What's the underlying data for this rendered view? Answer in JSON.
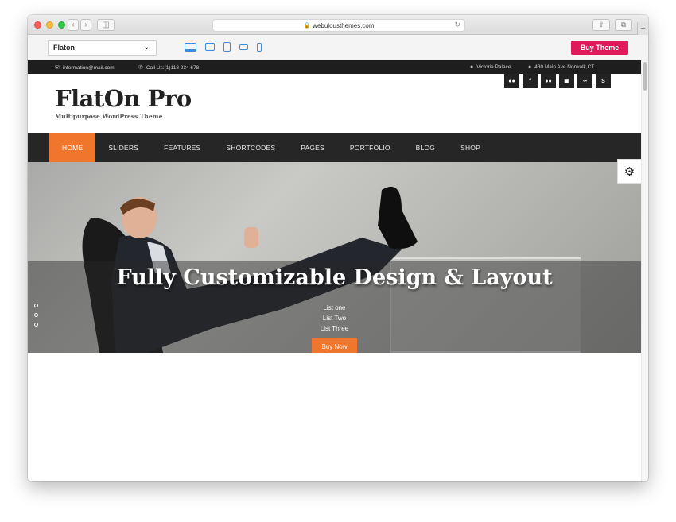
{
  "browser": {
    "url": "webulousthemes.com",
    "back_icon": "chevron-left",
    "forward_icon": "chevron-right"
  },
  "demobar": {
    "theme_selected": "Flaton",
    "buy_label": "Buy Theme",
    "buy_color": "#e0195a"
  },
  "topbar": {
    "email": "information@mail.com",
    "phone": "Call Us:(1)118 234 678",
    "location": "Victoria Palace",
    "address": "430 Main Ave Norwalk,CT"
  },
  "header": {
    "logo": "FlatOn Pro",
    "tagline": "Multipurpose WordPress Theme",
    "socials": [
      "flickr",
      "facebook",
      "flickr",
      "instagram",
      "rss",
      "skype"
    ]
  },
  "nav": {
    "items": [
      "HOME",
      "SLIDERS",
      "FEATURES",
      "SHORTCODES",
      "PAGES",
      "PORTFOLIO",
      "BLOG",
      "SHOP"
    ],
    "active_color": "#f0762e"
  },
  "hero": {
    "headline": "Fully Customizable Design & Layout",
    "list": [
      "List one",
      "List Two",
      "List Three"
    ],
    "button": "Buy Now"
  }
}
